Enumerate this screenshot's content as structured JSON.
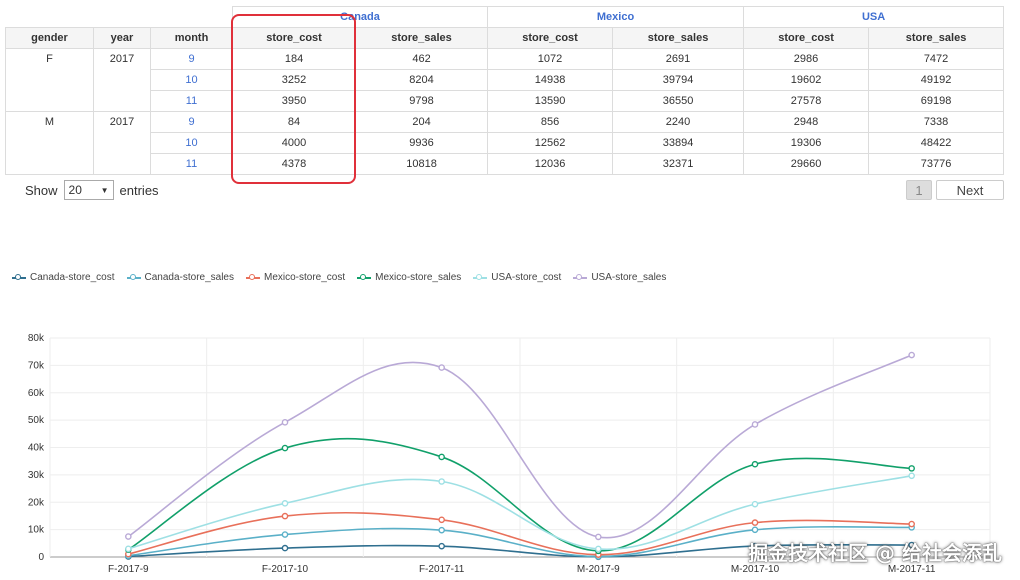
{
  "table": {
    "dims": [
      "gender",
      "year",
      "month"
    ],
    "countries": [
      "Canada",
      "Mexico",
      "USA"
    ],
    "measures": [
      "store_cost",
      "store_sales"
    ],
    "groups": [
      {
        "gender": "F",
        "year": "2017",
        "rows": [
          {
            "month": "9",
            "values": [
              "184",
              "462",
              "1072",
              "2691",
              "2986",
              "7472"
            ]
          },
          {
            "month": "10",
            "values": [
              "3252",
              "8204",
              "14938",
              "39794",
              "19602",
              "49192"
            ]
          },
          {
            "month": "11",
            "values": [
              "3950",
              "9798",
              "13590",
              "36550",
              "27578",
              "69198"
            ]
          }
        ]
      },
      {
        "gender": "M",
        "year": "2017",
        "rows": [
          {
            "month": "9",
            "values": [
              "84",
              "204",
              "856",
              "2240",
              "2948",
              "7338"
            ]
          },
          {
            "month": "10",
            "values": [
              "4000",
              "9936",
              "12562",
              "33894",
              "19306",
              "48422"
            ]
          },
          {
            "month": "11",
            "values": [
              "4378",
              "10818",
              "12036",
              "32371",
              "29660",
              "73776"
            ]
          }
        ]
      }
    ]
  },
  "controls": {
    "show_label": "Show",
    "page_size": "20",
    "entries_label": "entries",
    "current_page": "1",
    "next_label": "Next"
  },
  "chart_data": {
    "type": "line",
    "categories": [
      "F-2017-9",
      "F-2017-10",
      "F-2017-11",
      "M-2017-9",
      "M-2017-10",
      "M-2017-11"
    ],
    "ylim": [
      0,
      80000
    ],
    "yticks": [
      0,
      10000,
      20000,
      30000,
      40000,
      50000,
      60000,
      70000,
      80000
    ],
    "ytick_labels": [
      "0",
      "10k",
      "20k",
      "30k",
      "40k",
      "50k",
      "60k",
      "70k",
      "80k"
    ],
    "grid": true,
    "legend_position": "top-left",
    "series": [
      {
        "name": "Canada-store_cost",
        "color": "#2f6f8f",
        "values": [
          184,
          3252,
          3950,
          84,
          4000,
          4378
        ]
      },
      {
        "name": "Canada-store_sales",
        "color": "#5ab0c8",
        "values": [
          462,
          8204,
          9798,
          204,
          9936,
          10818
        ]
      },
      {
        "name": "Mexico-store_cost",
        "color": "#e8705a",
        "values": [
          1072,
          14938,
          13590,
          856,
          12562,
          12036
        ]
      },
      {
        "name": "Mexico-store_sales",
        "color": "#11a06a",
        "values": [
          2691,
          39794,
          36550,
          2240,
          33894,
          32371
        ]
      },
      {
        "name": "USA-store_cost",
        "color": "#9ee0e4",
        "values": [
          2986,
          19602,
          27578,
          2948,
          19306,
          29660
        ]
      },
      {
        "name": "USA-store_sales",
        "color": "#b9a9d6",
        "values": [
          7472,
          49192,
          69198,
          7338,
          48422,
          73776
        ]
      }
    ]
  },
  "watermark": "掘金技术社区 @ 给社会添乱"
}
